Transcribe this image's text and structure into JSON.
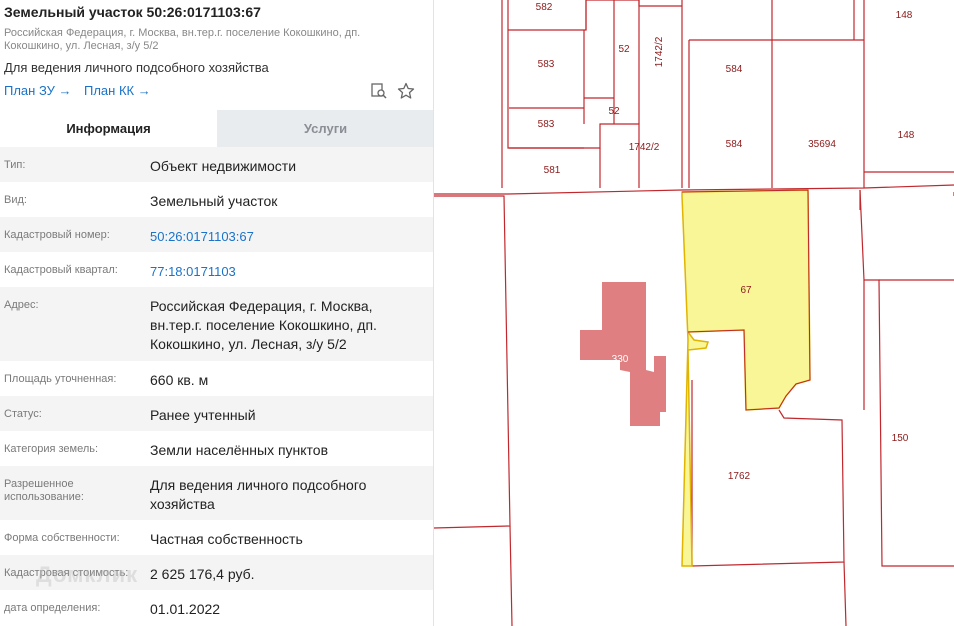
{
  "header": {
    "title": "Земельный участок 50:26:0171103:67",
    "address_sub": "Российская Федерация, г. Москва, вн.тер.г. поселение Кокошкино, дп. Кокошкино, ул. Лесная, з/у 5/2",
    "purpose": "Для ведения личного подсобного хозяйства",
    "plan_zu": "План ЗУ →",
    "plan_kk": "План КК →"
  },
  "tabs": [
    {
      "label": "Информация",
      "active": true
    },
    {
      "label": "Услуги",
      "active": false
    }
  ],
  "info": [
    {
      "label": "Тип:",
      "value": "Объект недвижимости"
    },
    {
      "label": "Вид:",
      "value": "Земельный участок"
    },
    {
      "label": "Кадастровый номер:",
      "value": "50:26:0171103:67"
    },
    {
      "label": "Кадастровый квартал:",
      "value": "77:18:0171103"
    },
    {
      "label": "Адрес:",
      "value": "Российская Федерация, г. Москва, вн.тер.г. поселение Кокошкино, дп. Кокошкино, ул. Лесная, з/у 5/2"
    },
    {
      "label": "Площадь уточненная:",
      "value": "660 кв. м"
    },
    {
      "label": "Статус:",
      "value": "Ранее учтенный"
    },
    {
      "label": "Категория земель:",
      "value": "Земли населённых пунктов"
    },
    {
      "label": "Разрешенное использование:",
      "value": "Для ведения личного подсобного хозяйства"
    },
    {
      "label": "Форма собственности:",
      "value": "Частная собственность"
    },
    {
      "label": "Кадастровая стоимость:",
      "value": "2 625 176,4 руб."
    },
    {
      "label": "дата определения:",
      "value": "01.01.2022"
    }
  ],
  "watermark": "Домклик",
  "map": {
    "parcel_labels": [
      "582",
      "148",
      "583",
      "52",
      "1742/2",
      "584",
      "52",
      "583",
      "148",
      "1742/2",
      "584",
      "35694",
      "581",
      "67",
      "330",
      "150",
      "1762"
    ],
    "colors": {
      "boundary": "#c0282d",
      "selected_fill": "#f7f58c",
      "selected_stroke": "#e0b400",
      "building_fill": "#d9686b",
      "link": "#1a73c8"
    }
  }
}
